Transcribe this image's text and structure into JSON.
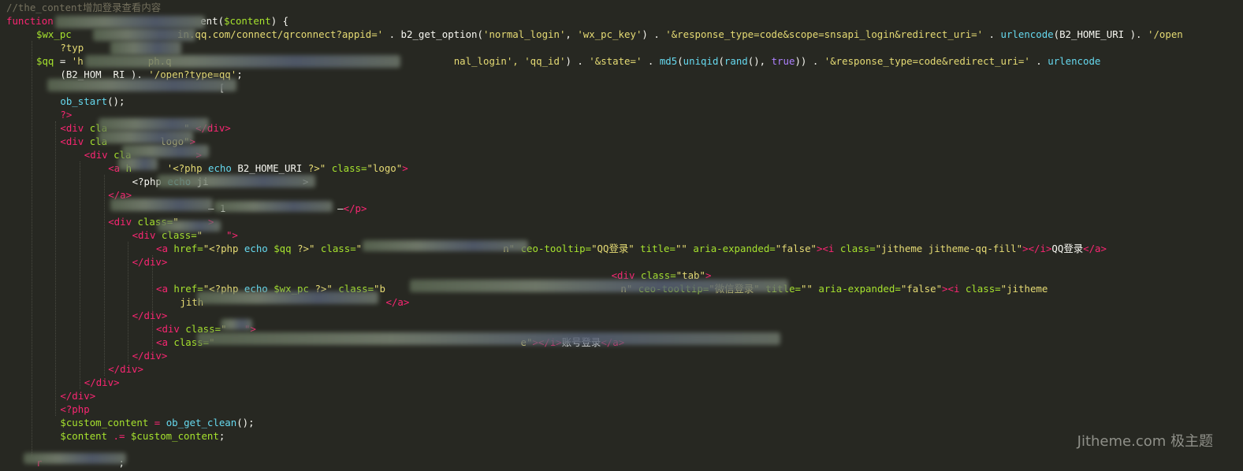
{
  "editor": {
    "theme": "dark",
    "colors": {
      "background": "#272822",
      "comment": "#75715e",
      "keyword": "#f92672",
      "function": "#66d9ef",
      "string": "#e6db74",
      "attribute": "#a6e22e"
    },
    "lines": [
      {
        "indent": 0,
        "tokens": [
          {
            "t": "//the_content增加登录查看内容",
            "c": "cm"
          }
        ]
      },
      {
        "indent": 0,
        "tokens": [
          {
            "t": "function ",
            "c": "kw"
          },
          {
            "t": "                        ",
            "c": "txt"
          },
          {
            "t": "ent(",
            "c": "txt"
          },
          {
            "t": "$content",
            "c": "var"
          },
          {
            "t": ") {",
            "c": "txt"
          }
        ]
      },
      {
        "indent": 5,
        "tokens": [
          {
            "t": "$wx_pc",
            "c": "var"
          },
          {
            "t": "                  ",
            "c": "txt"
          },
          {
            "t": "in.qq.com/connect/qrconnect?appid='",
            "c": "str"
          },
          {
            "t": " . ",
            "c": "txt"
          },
          {
            "t": "b2_get_option",
            "c": "txt"
          },
          {
            "t": "(",
            "c": "txt"
          },
          {
            "t": "'normal_login'",
            "c": "str"
          },
          {
            "t": ", ",
            "c": "txt"
          },
          {
            "t": "'wx_pc_key'",
            "c": "str"
          },
          {
            "t": ") . ",
            "c": "txt"
          },
          {
            "t": "'&response_type=code&scope=snsapi_login&redirect_uri='",
            "c": "str"
          },
          {
            "t": " . ",
            "c": "txt"
          },
          {
            "t": "urlencode",
            "c": "fn"
          },
          {
            "t": "(B2_HOME_URI ). ",
            "c": "txt"
          },
          {
            "t": "'/open",
            "c": "str"
          }
        ]
      },
      {
        "indent": 9,
        "tokens": [
          {
            "t": "?typ",
            "c": "str"
          }
        ]
      },
      {
        "indent": 5,
        "tokens": [
          {
            "t": "$qq",
            "c": "var"
          },
          {
            "t": " = ",
            "c": "txt"
          },
          {
            "t": "'h",
            "c": "str"
          },
          {
            "t": "           ",
            "c": "txt"
          },
          {
            "t": "ph.q",
            "c": "str"
          },
          {
            "t": "                                                ",
            "c": "txt"
          },
          {
            "t": "nal_login', 'qq_id'",
            "c": "str"
          },
          {
            "t": ") . ",
            "c": "txt"
          },
          {
            "t": "'&state='",
            "c": "str"
          },
          {
            "t": " . ",
            "c": "txt"
          },
          {
            "t": "md5",
            "c": "fn"
          },
          {
            "t": "(",
            "c": "txt"
          },
          {
            "t": "uniqid",
            "c": "fn"
          },
          {
            "t": "(",
            "c": "txt"
          },
          {
            "t": "rand",
            "c": "fn"
          },
          {
            "t": "(), ",
            "c": "txt"
          },
          {
            "t": "true",
            "c": "num"
          },
          {
            "t": ")) . ",
            "c": "txt"
          },
          {
            "t": "'&response_type=code&redirect_uri='",
            "c": "str"
          },
          {
            "t": " . ",
            "c": "txt"
          },
          {
            "t": "urlencode",
            "c": "fn"
          }
        ]
      },
      {
        "indent": 9,
        "tokens": [
          {
            "t": "(B2_HOM",
            "c": "txt"
          },
          {
            "t": "  ",
            "c": "txt"
          },
          {
            "t": "RI ). ",
            "c": "txt"
          },
          {
            "t": "'/open?type=qq'",
            "c": "str"
          },
          {
            "t": ";",
            "c": "txt"
          }
        ]
      },
      {
        "indent": 9,
        "tokens": [
          {
            "t": "                           [",
            "c": "txt"
          }
        ]
      },
      {
        "indent": 9,
        "tokens": [
          {
            "t": "ob_start",
            "c": "fn"
          },
          {
            "t": "();",
            "c": "txt"
          }
        ]
      },
      {
        "indent": 9,
        "tokens": [
          {
            "t": "?>",
            "c": "kw"
          }
        ]
      },
      {
        "indent": 9,
        "tokens": [
          {
            "t": "<div",
            "c": "tag"
          },
          {
            "t": " cla",
            "c": "attr"
          },
          {
            "t": "             ",
            "c": "txt"
          },
          {
            "t": "\"",
            "c": "str"
          },
          {
            "t": " ",
            "c": "txt"
          },
          {
            "t": "</div>",
            "c": "tag"
          }
        ]
      },
      {
        "indent": 9,
        "tokens": [
          {
            "t": "<div",
            "c": "tag"
          },
          {
            "t": " cla",
            "c": "attr"
          },
          {
            "t": "         ",
            "c": "txt"
          },
          {
            "t": "logo\"",
            "c": "str"
          },
          {
            "t": ">",
            "c": "tag"
          }
        ]
      },
      {
        "indent": 13,
        "tokens": [
          {
            "t": "<div",
            "c": "tag"
          },
          {
            "t": " cla",
            "c": "attr"
          },
          {
            "t": "           ",
            "c": "txt"
          },
          {
            "t": ">",
            "c": "tag"
          }
        ]
      },
      {
        "indent": 17,
        "tokens": [
          {
            "t": "<a",
            "c": "tag"
          },
          {
            "t": " h",
            "c": "attr"
          },
          {
            "t": "      ",
            "c": "txt"
          },
          {
            "t": "'<?php ",
            "c": "str"
          },
          {
            "t": "echo",
            "c": "fn"
          },
          {
            "t": " B2_HOME_URI ",
            "c": "txt"
          },
          {
            "t": "?>\"",
            "c": "str"
          },
          {
            "t": " class=",
            "c": "attr"
          },
          {
            "t": "\"logo\"",
            "c": "str"
          },
          {
            "t": ">",
            "c": "tag"
          }
        ]
      },
      {
        "indent": 21,
        "tokens": [
          {
            "t": "<?php ",
            "c": "txt"
          },
          {
            "t": "echo",
            "c": "fn"
          },
          {
            "t": " ji",
            "c": "txt"
          },
          {
            "t": "                ",
            "c": "txt"
          },
          {
            "t": ">",
            "c": "txt"
          }
        ]
      },
      {
        "indent": 17,
        "tokens": [
          {
            "t": "</a>",
            "c": "tag"
          }
        ]
      },
      {
        "indent": 17,
        "tokens": [
          {
            "t": "                 ",
            "c": "txt"
          },
          {
            "t": "— 1",
            "c": "txt"
          },
          {
            "t": "                   ",
            "c": "txt"
          },
          {
            "t": "—",
            "c": "txt"
          },
          {
            "t": "</p>",
            "c": "tag"
          }
        ]
      },
      {
        "indent": 17,
        "tokens": [
          {
            "t": "<div",
            "c": "tag"
          },
          {
            "t": " class=",
            "c": "attr"
          },
          {
            "t": "\"",
            "c": "str"
          },
          {
            "t": "     ",
            "c": "txt"
          },
          {
            "t": ">",
            "c": "tag"
          }
        ]
      },
      {
        "indent": 21,
        "tokens": [
          {
            "t": "<div",
            "c": "tag"
          },
          {
            "t": " class=",
            "c": "attr"
          },
          {
            "t": "\"",
            "c": "str"
          },
          {
            "t": "    ",
            "c": "txt"
          },
          {
            "t": "\">",
            "c": "tag"
          }
        ]
      },
      {
        "indent": 25,
        "tokens": [
          {
            "t": "<a",
            "c": "tag"
          },
          {
            "t": " href=",
            "c": "attr"
          },
          {
            "t": "\"<?php ",
            "c": "str"
          },
          {
            "t": "echo",
            "c": "fn"
          },
          {
            "t": " $qq ",
            "c": "var"
          },
          {
            "t": "?>\"",
            "c": "str"
          },
          {
            "t": " class=",
            "c": "attr"
          },
          {
            "t": "\"",
            "c": "str"
          },
          {
            "t": "                        ",
            "c": "txt"
          },
          {
            "t": "n\"",
            "c": "str"
          },
          {
            "t": " ceo-tooltip=",
            "c": "attr"
          },
          {
            "t": "\"QQ登录\"",
            "c": "str"
          },
          {
            "t": " title=",
            "c": "attr"
          },
          {
            "t": "\"\"",
            "c": "str"
          },
          {
            "t": " aria-expanded=",
            "c": "attr"
          },
          {
            "t": "\"false\"",
            "c": "str"
          },
          {
            "t": ">",
            "c": "tag"
          },
          {
            "t": "<i",
            "c": "tag"
          },
          {
            "t": " class=",
            "c": "attr"
          },
          {
            "t": "\"jitheme jitheme-qq-fill\"",
            "c": "str"
          },
          {
            "t": ">",
            "c": "tag"
          },
          {
            "t": "</i>",
            "c": "tag"
          },
          {
            "t": "QQ登录",
            "c": "txt"
          },
          {
            "t": "</a>",
            "c": "tag"
          }
        ]
      },
      {
        "indent": 21,
        "tokens": [
          {
            "t": "</div>",
            "c": "tag"
          }
        ]
      },
      {
        "indent": 101,
        "tokens": [
          {
            "t": "<div",
            "c": "tag"
          },
          {
            "t": " class=",
            "c": "attr"
          },
          {
            "t": "\"tab\"",
            "c": "str"
          },
          {
            "t": ">",
            "c": "tag"
          }
        ]
      },
      {
        "indent": 25,
        "tokens": [
          {
            "t": "<a",
            "c": "tag"
          },
          {
            "t": " href=",
            "c": "attr"
          },
          {
            "t": "\"<?php ",
            "c": "str"
          },
          {
            "t": "echo",
            "c": "fn"
          },
          {
            "t": " $wx_pc ",
            "c": "var"
          },
          {
            "t": "?>\"",
            "c": "str"
          },
          {
            "t": " class=",
            "c": "attr"
          },
          {
            "t": "\"b",
            "c": "str"
          },
          {
            "t": "                                        ",
            "c": "txt"
          },
          {
            "t": "n\"",
            "c": "str"
          },
          {
            "t": " ceo-tooltip=",
            "c": "attr"
          },
          {
            "t": "\"微信登录\"",
            "c": "str"
          },
          {
            "t": " title=",
            "c": "attr"
          },
          {
            "t": "\"\"",
            "c": "str"
          },
          {
            "t": " aria-expanded=",
            "c": "attr"
          },
          {
            "t": "\"false\"",
            "c": "str"
          },
          {
            "t": ">",
            "c": "tag"
          },
          {
            "t": "<i",
            "c": "tag"
          },
          {
            "t": " class=",
            "c": "attr"
          },
          {
            "t": "\"jitheme",
            "c": "str"
          }
        ]
      },
      {
        "indent": 29,
        "tokens": [
          {
            "t": "jith",
            "c": "str"
          },
          {
            "t": "                               ",
            "c": "txt"
          },
          {
            "t": "</a>",
            "c": "tag"
          }
        ]
      },
      {
        "indent": 21,
        "tokens": [
          {
            "t": "</div>",
            "c": "tag"
          }
        ]
      },
      {
        "indent": 25,
        "tokens": [
          {
            "t": "<div",
            "c": "tag"
          },
          {
            "t": " class=",
            "c": "attr"
          },
          {
            "t": "\"",
            "c": "str"
          },
          {
            "t": "   ",
            "c": "txt"
          },
          {
            "t": "\">",
            "c": "tag"
          }
        ]
      },
      {
        "indent": 25,
        "tokens": [
          {
            "t": "<a",
            "c": "tag"
          },
          {
            "t": " class=",
            "c": "attr"
          },
          {
            "t": "\"",
            "c": "str"
          },
          {
            "t": "                                                    ",
            "c": "txt"
          },
          {
            "t": "e\"",
            "c": "str"
          },
          {
            "t": ">",
            "c": "tag"
          },
          {
            "t": "</i>",
            "c": "tag"
          },
          {
            "t": "账号登录",
            "c": "txt"
          },
          {
            "t": "</a>",
            "c": "tag"
          }
        ]
      },
      {
        "indent": 21,
        "tokens": [
          {
            "t": "</div>",
            "c": "tag"
          }
        ]
      },
      {
        "indent": 17,
        "tokens": [
          {
            "t": "</div>",
            "c": "tag"
          }
        ]
      },
      {
        "indent": 13,
        "tokens": [
          {
            "t": "</div>",
            "c": "tag"
          }
        ]
      },
      {
        "indent": 9,
        "tokens": [
          {
            "t": "</div>",
            "c": "tag"
          }
        ]
      },
      {
        "indent": 9,
        "tokens": [
          {
            "t": "<?php",
            "c": "kw"
          }
        ]
      },
      {
        "indent": 9,
        "tokens": [
          {
            "t": "$custom_content",
            "c": "var"
          },
          {
            "t": " = ",
            "c": "kw"
          },
          {
            "t": "ob_get_clean",
            "c": "fn"
          },
          {
            "t": "();",
            "c": "txt"
          }
        ]
      },
      {
        "indent": 9,
        "tokens": [
          {
            "t": "$content",
            "c": "var"
          },
          {
            "t": " .= ",
            "c": "kw"
          },
          {
            "t": "$custom_content",
            "c": "var"
          },
          {
            "t": ";",
            "c": "txt"
          }
        ]
      },
      {
        "indent": 5,
        "tokens": [
          {
            "t": "",
            "c": "txt"
          }
        ]
      },
      {
        "indent": 5,
        "tokens": [
          {
            "t": "r",
            "c": "kw"
          },
          {
            "t": "             ",
            "c": "txt"
          },
          {
            "t": ";",
            "c": "txt"
          }
        ]
      }
    ]
  },
  "watermark": "Jitheme.com 极主题"
}
